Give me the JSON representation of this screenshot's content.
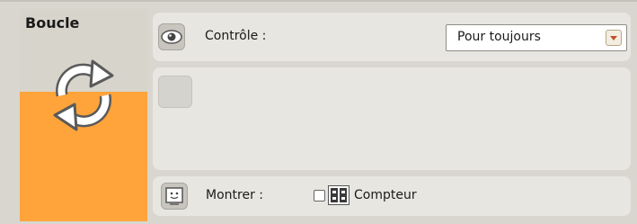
{
  "block": {
    "title": "Boucle",
    "accent_color": "#ffa43a"
  },
  "control": {
    "label": "Contrôle :",
    "value": "Pour toujours"
  },
  "show": {
    "label": "Montrer :",
    "counter_label": "Compteur",
    "counter_checked": false
  },
  "icons": {
    "block": "loop-icon",
    "control": "eye-icon",
    "show": "face-icon",
    "counter": "counter-icon",
    "dropdown": "chevron-down-icon"
  }
}
